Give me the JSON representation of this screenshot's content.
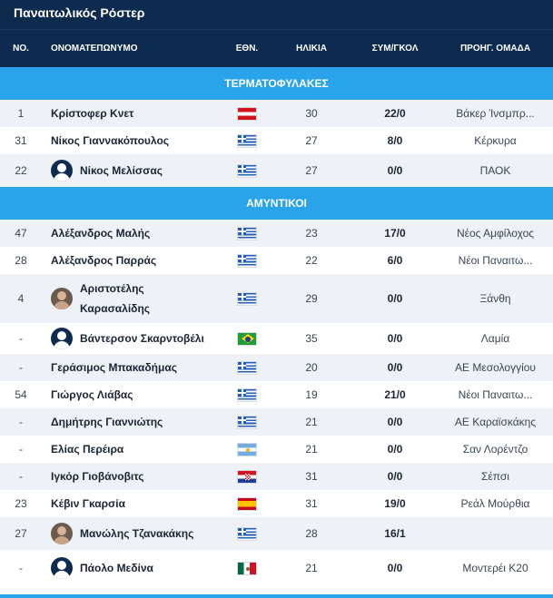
{
  "title": "Παναιτωλικός Ρόστερ",
  "columns": {
    "no": "ΝΟ.",
    "name": "ΟΝΟΜΑΤΕΠΩΝΥΜΟ",
    "nat": "ΕΘΝ.",
    "age": "ΗΛΙΚΙΑ",
    "apps": "ΣΥΜ/ΓΚΟΛ",
    "prev": "ΠΡΟΗΓ. ΟΜΑΔΑ"
  },
  "sections": [
    {
      "label": "ΤΕΡΜΑΤΟΦΥΛΑΚΕΣ",
      "players": [
        {
          "no": "1",
          "name": "Κρίστοφερ Κνετ",
          "flag": "at",
          "flag_icon": "austria-flag-icon",
          "age": "30",
          "apps": "22/0",
          "prev": "Βάκερ Ίνσμπρ...",
          "avatar": "none"
        },
        {
          "no": "31",
          "name": "Νίκος Γιαννακόπουλος",
          "flag": "gr",
          "flag_icon": "greece-flag-icon",
          "age": "27",
          "apps": "8/0",
          "prev": "Κέρκυρα",
          "avatar": "none"
        },
        {
          "no": "22",
          "name": "Νίκος Μελίσσας",
          "flag": "gr",
          "flag_icon": "greece-flag-icon",
          "age": "27",
          "apps": "0/0",
          "prev": "ΠΑΟΚ",
          "avatar": "silhouette"
        }
      ]
    },
    {
      "label": "ΑΜΥΝΤΙΚΟΙ",
      "players": [
        {
          "no": "47",
          "name": "Αλέξανδρος Μαλής",
          "flag": "gr",
          "flag_icon": "greece-flag-icon",
          "age": "23",
          "apps": "17/0",
          "prev": "Νέος Αμφίλοχος",
          "avatar": "none"
        },
        {
          "no": "28",
          "name": "Αλέξανδρος Παρράς",
          "flag": "gr",
          "flag_icon": "greece-flag-icon",
          "age": "22",
          "apps": "6/0",
          "prev": "Νέοι Παναιτω...",
          "avatar": "none"
        },
        {
          "no": "4",
          "name": "Αριστοτέλης Καρασαλίδης",
          "name_line1": "Αριστοτέλης",
          "name_line2": "Καρασαλίδης",
          "flag": "gr",
          "flag_icon": "greece-flag-icon",
          "age": "29",
          "apps": "0/0",
          "prev": "Ξάνθη",
          "avatar": "photo"
        },
        {
          "no": "-",
          "name": "Βάντερσον Σκαρντοβέλι",
          "flag": "br",
          "flag_icon": "brazil-flag-icon",
          "age": "35",
          "apps": "0/0",
          "prev": "Λαμία",
          "avatar": "silhouette"
        },
        {
          "no": "-",
          "name": "Γεράσιμος Μπακαδήμας",
          "flag": "gr",
          "flag_icon": "greece-flag-icon",
          "age": "20",
          "apps": "0/0",
          "prev": "ΑΕ Μεσολογγίου",
          "avatar": "none"
        },
        {
          "no": "54",
          "name": "Γιώργος Λιάβας",
          "flag": "gr",
          "flag_icon": "greece-flag-icon",
          "age": "19",
          "apps": "21/0",
          "prev": "Νέοι Παναιτω...",
          "avatar": "none"
        },
        {
          "no": "-",
          "name": "Δημήτρης Γιαννιώτης",
          "flag": "gr",
          "flag_icon": "greece-flag-icon",
          "age": "21",
          "apps": "0/0",
          "prev": "ΑΕ Καραϊσκάκης",
          "avatar": "none"
        },
        {
          "no": "-",
          "name": "Ελίας Περέιρα",
          "flag": "ar",
          "flag_icon": "argentina-flag-icon",
          "age": "21",
          "apps": "0/0",
          "prev": "Σαν Λορέντζο",
          "avatar": "none"
        },
        {
          "no": "-",
          "name": "Ιγκόρ Γιοβάνοβιτς",
          "flag": "hr",
          "flag_icon": "croatia-flag-icon",
          "age": "31",
          "apps": "0/0",
          "prev": "Σέπσι",
          "avatar": "none"
        },
        {
          "no": "23",
          "name": "Κέβιν Γκαρσία",
          "flag": "es",
          "flag_icon": "spain-flag-icon",
          "age": "31",
          "apps": "19/0",
          "prev": "Ρεάλ Μούρθια",
          "avatar": "none"
        },
        {
          "no": "27",
          "name": "Μανώλης Τζανακάκης",
          "flag": "gr",
          "flag_icon": "greece-flag-icon",
          "age": "28",
          "apps": "16/1",
          "prev": "",
          "avatar": "photo"
        },
        {
          "no": "-",
          "name": "Πάολο Μεδίνα",
          "flag": "mx",
          "flag_icon": "mexico-flag-icon",
          "age": "21",
          "apps": "0/0",
          "prev": "Μοντερέι Κ20",
          "avatar": "silhouette"
        }
      ]
    }
  ],
  "colors": {
    "header_bg": "#0d2b4e",
    "section_bg": "#29a3ea",
    "row_alt_bg": "#eef1f5"
  }
}
